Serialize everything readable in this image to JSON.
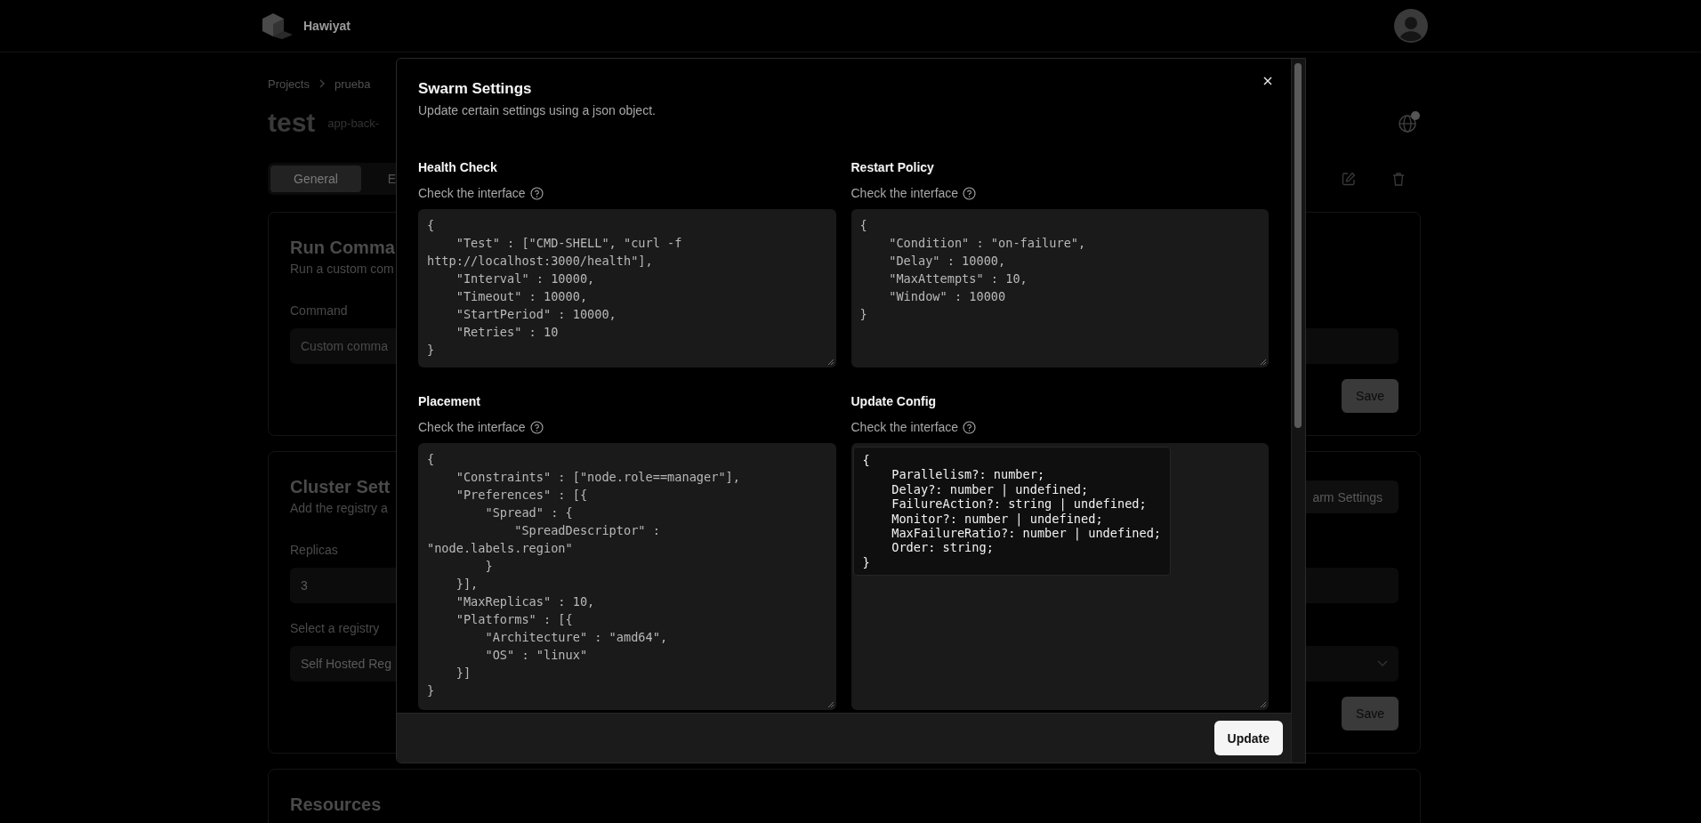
{
  "app": {
    "name": "Hawiyat"
  },
  "breadcrumb": [
    "Projects",
    "prueba"
  ],
  "page": {
    "title": "test",
    "subtitle": "app-back-"
  },
  "tabs": [
    {
      "label": "General",
      "selected": true
    },
    {
      "label": "E",
      "selected": false
    }
  ],
  "cards": [
    {
      "title": "Run Comma",
      "description": "Run a custom com",
      "fields": [
        {
          "kind": "input",
          "label": "Command",
          "placeholder": "Custom comma"
        }
      ],
      "buttons": [
        "Save"
      ]
    },
    {
      "title": "Cluster Sett",
      "description": "Add the registry a",
      "header_button": "arm Settings",
      "fields": [
        {
          "kind": "input",
          "label": "Replicas",
          "value": "3"
        },
        {
          "kind": "select",
          "label": "Select a registry",
          "value": "Self Hosted Reg"
        }
      ],
      "buttons": [
        "Save"
      ]
    },
    {
      "title": "Resources"
    }
  ],
  "modal": {
    "title": "Swarm Settings",
    "description": "Update certain settings using a json object.",
    "sections": [
      {
        "label": "Health Check",
        "hint": "Check the interface",
        "value": "{\n    \"Test\" : [\"CMD-SHELL\", \"curl -f http://localhost:3000/health\"],\n    \"Interval\" : 10000,\n    \"Timeout\" : 10000,\n    \"StartPeriod\" : 10000,\n    \"Retries\" : 10\n}"
      },
      {
        "label": "Restart Policy",
        "hint": "Check the interface",
        "value": "{\n    \"Condition\" : \"on-failure\",\n    \"Delay\" : 10000,\n    \"MaxAttempts\" : 10,\n    \"Window\" : 10000\n}"
      },
      {
        "label": "Placement",
        "hint": "Check the interface",
        "value": "{\n    \"Constraints\" : [\"node.role==manager\"],\n    \"Preferences\" : [{\n        \"Spread\" : {\n            \"SpreadDescriptor\" : \"node.labels.region\"\n        }\n    }],\n    \"MaxReplicas\" : 10,\n    \"Platforms\" : [{\n        \"Architecture\" : \"amd64\",\n        \"OS\" : \"linux\"\n    }]\n}"
      },
      {
        "label": "Update Config",
        "hint": "Check the interface",
        "tooltip": "{\n    Parallelism?: number;\n    Delay?: number | undefined;\n    FailureAction?: string | undefined;\n    Monitor?: number | undefined;\n    MaxFailureRatio?: number | undefined;\n    Order: string;\n}"
      }
    ],
    "buttons": [
      "Update"
    ]
  }
}
